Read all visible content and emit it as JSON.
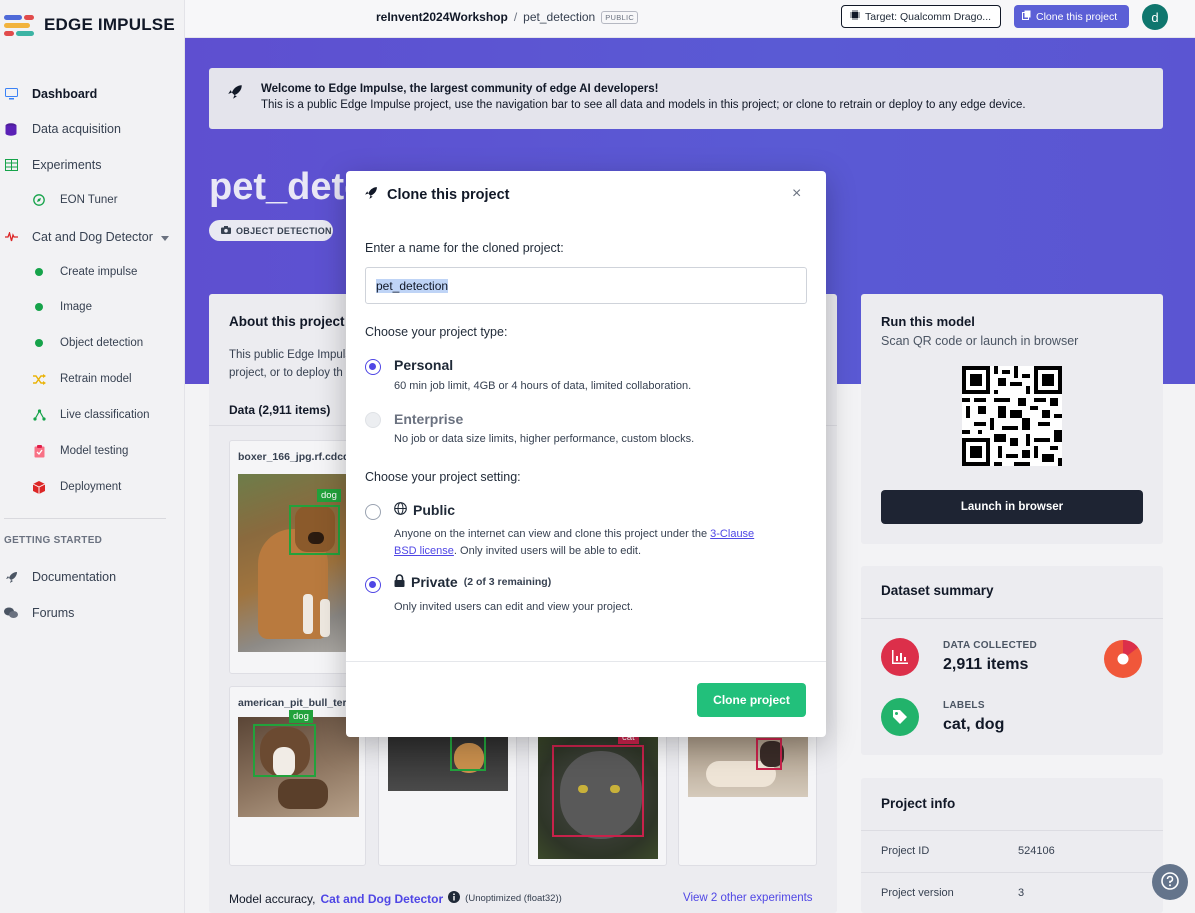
{
  "app": {
    "name": "EDGE IMPULSE"
  },
  "sidebar": {
    "items": [
      {
        "label": "Dashboard"
      },
      {
        "label": "Data acquisition"
      },
      {
        "label": "Experiments"
      },
      {
        "label": "EON Tuner"
      },
      {
        "label": "Cat and Dog Detector"
      },
      {
        "label": "Create impulse"
      },
      {
        "label": "Image"
      },
      {
        "label": "Object detection"
      },
      {
        "label": "Retrain model"
      },
      {
        "label": "Live classification"
      },
      {
        "label": "Model testing"
      },
      {
        "label": "Deployment"
      }
    ],
    "getting_started": "GETTING STARTED",
    "gs_items": [
      {
        "label": "Documentation"
      },
      {
        "label": "Forums"
      }
    ]
  },
  "topbar": {
    "org": "reInvent2024Workshop",
    "separator": "/",
    "project": "pet_detection",
    "visibility": "PUBLIC",
    "target": "Target: Qualcomm Drago...",
    "clone": "Clone this project",
    "avatar": "d"
  },
  "welcome": {
    "title": "Welcome to Edge Impulse, the largest community of edge AI developers!",
    "text": "This is a public Edge Impulse project, use the navigation bar to see all data and models in this project; or clone to retrain or deploy to any edge device."
  },
  "project": {
    "title": "pet_detection",
    "type_badge": "OBJECT DETECTION"
  },
  "about": {
    "title": "About this project",
    "desc": "This public Edge Impulse project, or to deploy th",
    "data_header": "Data (2,911 items)",
    "tiles": [
      {
        "file": "boxer_166_jpg.rf.cdcd",
        "label": "dog"
      },
      {
        "file": "american_pit_bull_ter",
        "label": "dog"
      },
      {
        "file": "",
        "label": ""
      },
      {
        "file": "",
        "label": "cat"
      },
      {
        "file": "",
        "label": ""
      }
    ],
    "accuracy_prefix": "Model accuracy,",
    "accuracy_link": "Cat and Dog Detector",
    "accuracy_note": "(Unoptimized (float32))",
    "view_other": "View 2 other experiments"
  },
  "run": {
    "title": "Run this model",
    "subtitle": "Scan QR code or launch in browser",
    "launch": "Launch in browser"
  },
  "summary": {
    "title": "Dataset summary",
    "collected_label": "DATA COLLECTED",
    "collected_value": "2,911 items",
    "labels_label": "LABELS",
    "labels_value": "cat, dog"
  },
  "info": {
    "title": "Project info",
    "rows": [
      {
        "key": "Project ID",
        "value": "524106"
      },
      {
        "key": "Project version",
        "value": "3"
      }
    ]
  },
  "modal": {
    "title": "Clone this project",
    "close": "×",
    "name_label": "Enter a name for the cloned project:",
    "name_value": "pet_detection",
    "type_label": "Choose your project type:",
    "personal_title": "Personal",
    "personal_desc": "60 min job limit, 4GB or 4 hours of data, limited collaboration.",
    "enterprise_title": "Enterprise",
    "enterprise_desc": "No job or data size limits, higher performance, custom blocks.",
    "setting_label": "Choose your project setting:",
    "public_title": "Public",
    "public_desc_1": "Anyone on the internet can view and clone this project under the",
    "public_link": "3-Clause BSD license",
    "public_desc_2": ". Only invited users will be able to edit.",
    "private_title": "Private",
    "private_note": "(2 of 3 remaining)",
    "private_desc": "Only invited users can edit and view your project.",
    "clone_button": "Clone project"
  },
  "colors": {
    "brand": "#5b5fd6",
    "hero": "#5a52d2",
    "green": "#22c07b",
    "dog_box": "#22a23c",
    "cat_box": "#c8224b",
    "radio_selected": "#4f46e5"
  }
}
